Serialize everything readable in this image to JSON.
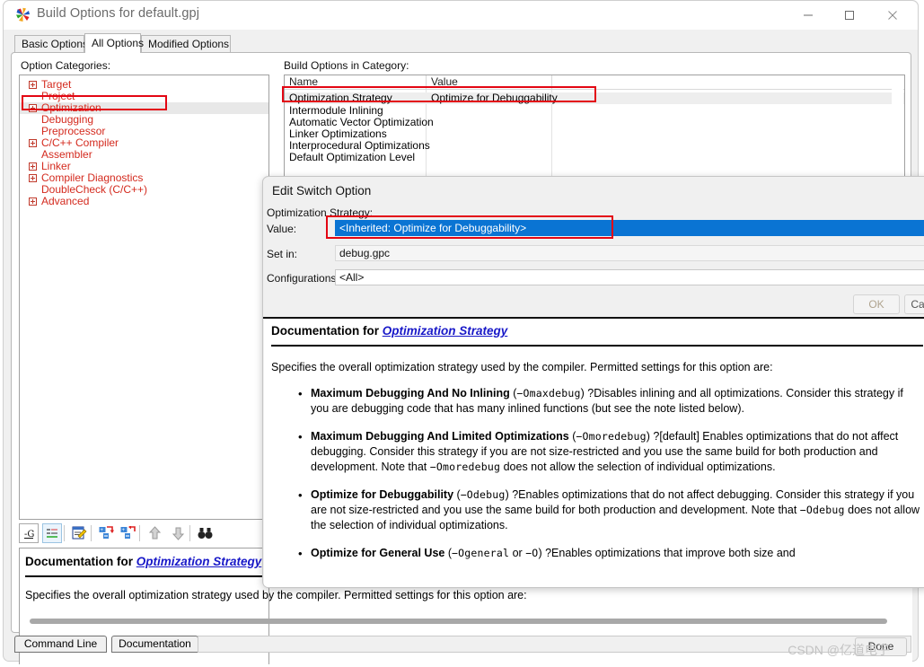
{
  "window": {
    "title": "Build Options for default.gpj",
    "icon": "pinwheel-app-icon",
    "minimize": "—",
    "maximize": "□",
    "close": "✕"
  },
  "tabs": [
    {
      "label": "Basic Options",
      "active": false
    },
    {
      "label": "All Options",
      "active": true
    },
    {
      "label": "Modified Options",
      "active": false
    }
  ],
  "labels": {
    "option_categories": "Option Categories:",
    "build_options_in_category": "Build Options in Category:"
  },
  "tree": {
    "items": [
      {
        "label": "Target",
        "expandable": true,
        "selected": false
      },
      {
        "label": "Project",
        "expandable": false,
        "selected": false
      },
      {
        "label": "Optimization",
        "expandable": true,
        "selected": true
      },
      {
        "label": "Debugging",
        "expandable": false,
        "selected": false
      },
      {
        "label": "Preprocessor",
        "expandable": false,
        "selected": false
      },
      {
        "label": "C/C++ Compiler",
        "expandable": true,
        "selected": false
      },
      {
        "label": "Assembler",
        "expandable": false,
        "selected": false
      },
      {
        "label": "Linker",
        "expandable": true,
        "selected": false
      },
      {
        "label": "Compiler Diagnostics",
        "expandable": true,
        "selected": false
      },
      {
        "label": "DoubleCheck (C/C++)",
        "expandable": false,
        "selected": false
      },
      {
        "label": "Advanced",
        "expandable": true,
        "selected": false
      }
    ]
  },
  "options_list": {
    "columns": [
      "Name",
      "Value",
      ""
    ],
    "rows": [
      {
        "name": "Optimization Strategy",
        "value": "Optimize for Debuggability",
        "selected": true
      },
      {
        "name": "Intermodule Inlining",
        "value": "",
        "selected": false
      },
      {
        "name": "Automatic Vector Optimization",
        "value": "",
        "selected": false
      },
      {
        "name": "Linker Optimizations",
        "value": "",
        "selected": false
      },
      {
        "name": "Interprocedural Optimizations",
        "value": "",
        "selected": false
      },
      {
        "name": "Default Optimization Level",
        "value": "",
        "selected": false
      }
    ]
  },
  "toolbar": {
    "buttons": [
      "show-switches-icon",
      "show-options-list-icon",
      "edit-option-icon",
      "add-option-icon",
      "remove-option-icon",
      "move-up-icon",
      "move-down-icon",
      "find-icon"
    ]
  },
  "dialog": {
    "title": "Edit Switch Option",
    "option_name_label": "Optimization Strategy:",
    "value_label": "Value:",
    "value": "<Inherited: Optimize for Debuggability>",
    "setin_label": "Set in:",
    "setin": "debug.gpc",
    "configurations_label": "Configurations:",
    "configurations": "<All>",
    "ok_label": "OK",
    "cancel_label": "Cancel",
    "doc": {
      "heading_prefix": "Documentation for ",
      "heading_link": "Optimization Strategy",
      "intro": "Specifies the overall optimization strategy used by the compiler. Permitted settings for this option are:",
      "bullets": [
        {
          "term": "Maximum Debugging And No Inlining",
          "switch": "−Omaxdebug",
          "text": "?Disables inlining and all optimizations. Consider this strategy if you are debugging code that has many inlined functions (but see the note listed below)."
        },
        {
          "term": "Maximum Debugging And Limited Optimizations",
          "switch": "−Omoredebug",
          "text": "?[default] Enables optimizations that do not affect debugging. Consider this strategy if you are not size-restricted and you use the same build for both production and development. Note that ",
          "switch2": "−Omoredebug",
          "text2": " does not allow the selection of individual optimizations."
        },
        {
          "term": "Optimize for Debuggability",
          "switch": "−Odebug",
          "text": "?Enables optimizations that do not affect debugging. Consider this strategy if you are not size-restricted and you use the same build for both production and development. Note that ",
          "switch2": "−Odebug",
          "text2": " does not allow the selection of individual optimizations."
        },
        {
          "term": "Optimize for General Use",
          "switch": "−Ogeneral",
          "switch_join": " or ",
          "switch_b": "−O",
          "text": "?Enables optimizations that improve both size and"
        }
      ]
    }
  },
  "main_doc": {
    "heading_prefix": "Documentation for ",
    "heading_link": "Optimization Strategy",
    "body": "Specifies the overall optimization strategy used by the compiler. Permitted settings for this option are:"
  },
  "bottom": {
    "tabs": [
      "Command Line",
      "Documentation"
    ],
    "status_value": "",
    "done_label": "Done"
  },
  "watermark": "CSDN @亿道电子",
  "colors": {
    "tree_text": "#d42a1e",
    "highlight_box": "#e30613",
    "selection_blue": "#0a74d3",
    "link_blue": "#1818c8"
  }
}
